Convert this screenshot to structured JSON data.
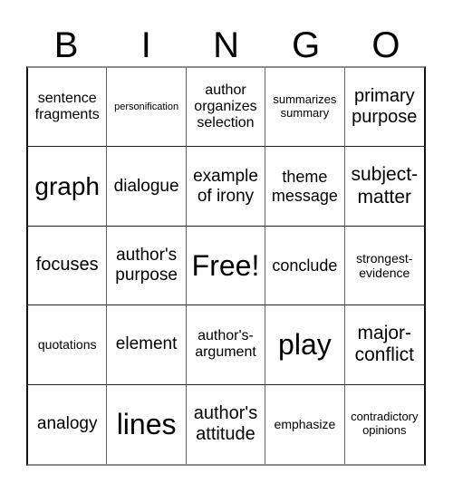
{
  "title_letters": [
    "B",
    "I",
    "N",
    "G",
    "O"
  ],
  "cells": [
    [
      "sentence fragments",
      "personification",
      "author organizes selection",
      "summarizes summary",
      "primary purpose"
    ],
    [
      "graph",
      "dialogue",
      "example of irony",
      "theme message",
      "subject-matter"
    ],
    [
      "focuses",
      "author's purpose",
      "Free!",
      "conclude",
      "strongest-evidence"
    ],
    [
      "quotations",
      "element",
      "author's-argument",
      "play",
      "major-conflict"
    ],
    [
      "analogy",
      "lines",
      "author's attitude",
      "emphasize",
      "contradictory opinions"
    ]
  ],
  "cell_lines": [
    [
      [
        "sentence",
        "fragments"
      ],
      [
        "personification"
      ],
      [
        "author",
        "organizes",
        "selection"
      ],
      [
        "summarizes",
        "summary"
      ],
      [
        "primary",
        "purpose"
      ]
    ],
    [
      [
        "graph"
      ],
      [
        "dialogue"
      ],
      [
        "example",
        "of irony"
      ],
      [
        "theme",
        "message"
      ],
      [
        "subject-",
        "matter"
      ]
    ],
    [
      [
        "focuses"
      ],
      [
        "author's",
        "purpose"
      ],
      [
        "Free!"
      ],
      [
        "conclude"
      ],
      [
        "strongest-",
        "evidence"
      ]
    ],
    [
      [
        "quotations"
      ],
      [
        "element"
      ],
      [
        "author's-",
        "argument"
      ],
      [
        "play"
      ],
      [
        "major-",
        "conflict"
      ]
    ],
    [
      [
        "analogy"
      ],
      [
        "lines"
      ],
      [
        "author's",
        "attitude"
      ],
      [
        "emphasize"
      ],
      [
        "contradictory",
        "opinions"
      ]
    ]
  ]
}
